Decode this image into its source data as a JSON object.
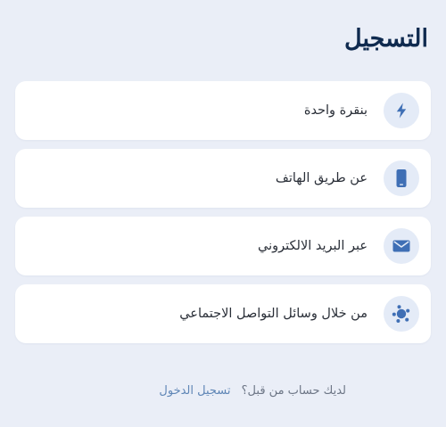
{
  "page": {
    "title": "التسجيل"
  },
  "options": [
    {
      "label": "بنقرة واحدة",
      "icon": "lightning-icon"
    },
    {
      "label": "عن طريق الهاتف",
      "icon": "phone-icon"
    },
    {
      "label": "عبر البريد الالكتروني",
      "icon": "mail-icon"
    },
    {
      "label": "من خلال وسائل التواصل الاجتماعي",
      "icon": "social-network-icon"
    }
  ],
  "footer": {
    "text": "لديك حساب من قبل؟",
    "link": "تسجيل الدخول"
  },
  "colors": {
    "background": "#eaeef7",
    "card": "#ffffff",
    "icon_circle": "#e4ebf7",
    "icon_accent": "#3f6fb5",
    "title": "#0f2a4f",
    "link": "#5f86b6"
  }
}
